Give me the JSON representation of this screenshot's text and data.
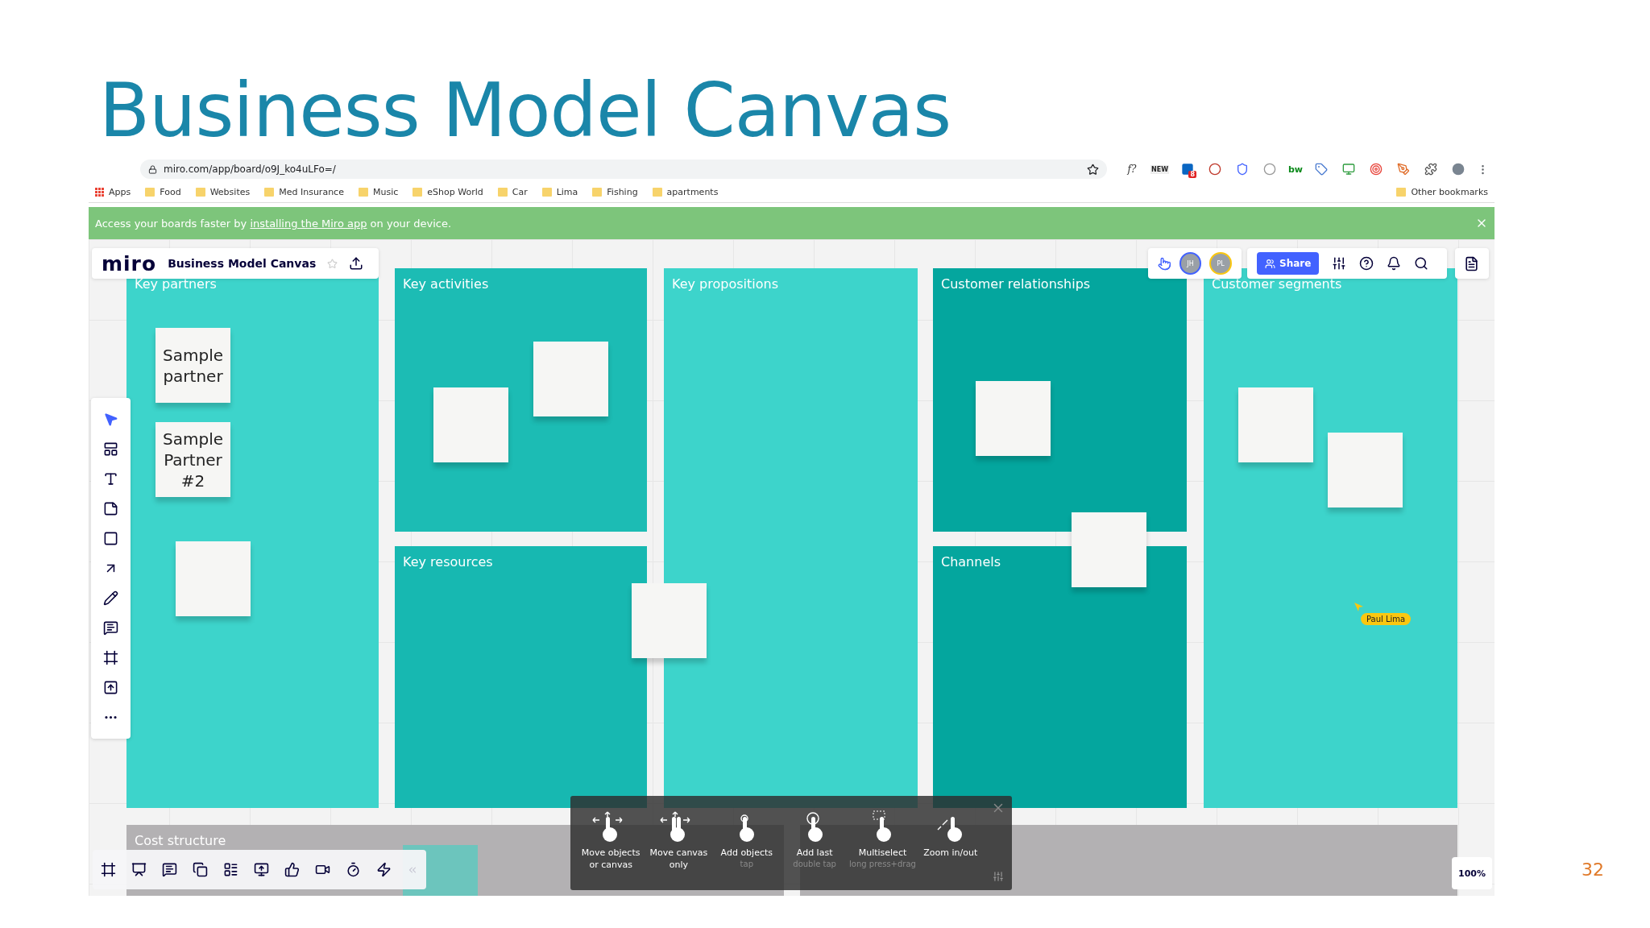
{
  "slide": {
    "title": "Business Model Canvas",
    "page_number": "32"
  },
  "browser": {
    "url": "miro.com/app/board/o9J_ko4uLFo=/",
    "extensions": [
      {
        "kind": "formula",
        "label": "f?"
      },
      {
        "kind": "news",
        "label": "NEW"
      },
      {
        "kind": "linkedin",
        "badge": "8"
      },
      {
        "kind": "record"
      },
      {
        "kind": "shield"
      },
      {
        "kind": "coin"
      },
      {
        "kind": "wordmark",
        "label": "bw"
      },
      {
        "kind": "tag"
      },
      {
        "kind": "screen"
      },
      {
        "kind": "target"
      },
      {
        "kind": "pen"
      },
      {
        "kind": "puzzle"
      },
      {
        "kind": "profile"
      }
    ],
    "bookmarks": [
      {
        "kind": "apps",
        "label": "Apps"
      },
      {
        "kind": "folder",
        "label": "Food"
      },
      {
        "kind": "folder",
        "label": "Websites"
      },
      {
        "kind": "folder",
        "label": "Med Insurance"
      },
      {
        "kind": "folder",
        "label": "Music"
      },
      {
        "kind": "folder",
        "label": "eShop World"
      },
      {
        "kind": "folder",
        "label": "Car"
      },
      {
        "kind": "folder",
        "label": "Lima"
      },
      {
        "kind": "folder",
        "label": "Fishing"
      },
      {
        "kind": "folder",
        "label": "apartments"
      }
    ],
    "other_bookmarks": "Other bookmarks"
  },
  "banner": {
    "before": "Access your boards faster by ",
    "link": "installing the Miro app",
    "after": " on your device."
  },
  "board": {
    "logo": "miro",
    "title": "Business Model Canvas",
    "starred": false,
    "collaborators": [
      {
        "initials": "JH",
        "color": "#4262ff"
      },
      {
        "initials": "PL",
        "color": "#fac710"
      }
    ],
    "share": "Share",
    "zoom": "100%",
    "sections": [
      {
        "title": "Key partners",
        "color": "#3dd4cb",
        "notes": [
          {
            "kind": "text",
            "text": "Sample partner"
          },
          {
            "kind": "text",
            "text": "Sample Partner #2"
          },
          {
            "kind": "blank"
          }
        ]
      },
      {
        "title": "Key activities",
        "color": "#1cbcb4",
        "notes": [
          {
            "kind": "blank"
          },
          {
            "kind": "blank"
          }
        ]
      },
      {
        "title": "Key resources",
        "color": "#17b8b1",
        "notes": [
          {
            "kind": "blank"
          }
        ]
      },
      {
        "title": "Key propositions",
        "color": "#3dd4cb"
      },
      {
        "title": "Customer relationships",
        "color": "#04a69e",
        "notes": [
          {
            "kind": "blank"
          }
        ]
      },
      {
        "title": "Channels",
        "color": "#04a69e",
        "notes": [
          {
            "kind": "blank"
          }
        ]
      },
      {
        "title": "Customer segments",
        "color": "#3dd4cb",
        "notes": [
          {
            "kind": "blank"
          },
          {
            "kind": "blank"
          }
        ]
      }
    ],
    "cost_structure": "Cost structure",
    "cursor": {
      "name": "Paul Lima",
      "color": "#fac710"
    },
    "tools": [
      {
        "kind": "select",
        "selected": true
      },
      {
        "kind": "templates",
        "selected": false
      },
      {
        "kind": "text",
        "selected": false
      },
      {
        "kind": "sticky",
        "selected": false
      },
      {
        "kind": "shape",
        "selected": false
      },
      {
        "kind": "arrow",
        "selected": false
      },
      {
        "kind": "pen",
        "selected": false
      },
      {
        "kind": "comment",
        "selected": false
      },
      {
        "kind": "frame",
        "selected": false
      },
      {
        "kind": "upload",
        "selected": false
      },
      {
        "kind": "more",
        "selected": false
      }
    ],
    "bottom_tools": [
      {
        "kind": "frames"
      },
      {
        "kind": "present"
      },
      {
        "kind": "chat"
      },
      {
        "kind": "cards"
      },
      {
        "kind": "list"
      },
      {
        "kind": "screen-share"
      },
      {
        "kind": "vote"
      },
      {
        "kind": "video"
      },
      {
        "kind": "timer"
      },
      {
        "kind": "apps"
      },
      {
        "kind": "collapse"
      }
    ],
    "gestures": [
      {
        "label": "Move objects or canvas",
        "kind": "one-finger"
      },
      {
        "label": "Move canvas only",
        "kind": "two-finger"
      },
      {
        "label": "Add objects",
        "hint": "tap",
        "kind": "tap"
      },
      {
        "label": "Add last",
        "hint": "double tap",
        "kind": "double-tap"
      },
      {
        "label": "Multiselect",
        "hint": "long press+drag",
        "kind": "select"
      },
      {
        "label": "Zoom in/out",
        "kind": "zoom"
      }
    ]
  }
}
